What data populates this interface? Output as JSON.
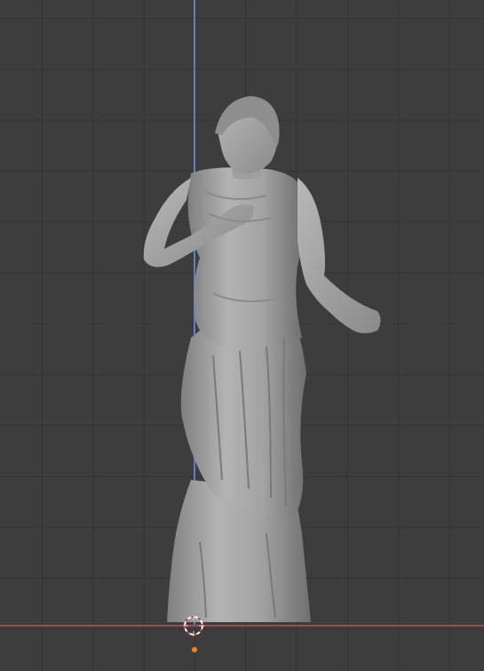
{
  "viewport": {
    "background_color": "#3d3d3d",
    "grid_color": "#333333",
    "axis_z_color": "#5a80c8",
    "axis_x_color": "#9a4a52",
    "origin_color": "#e8862e"
  },
  "object": {
    "description_icon": "sculpted-figure-mesh",
    "material_color": "#a9a9a9"
  },
  "scene_cursor": {
    "icon": "3d-cursor-icon"
  }
}
